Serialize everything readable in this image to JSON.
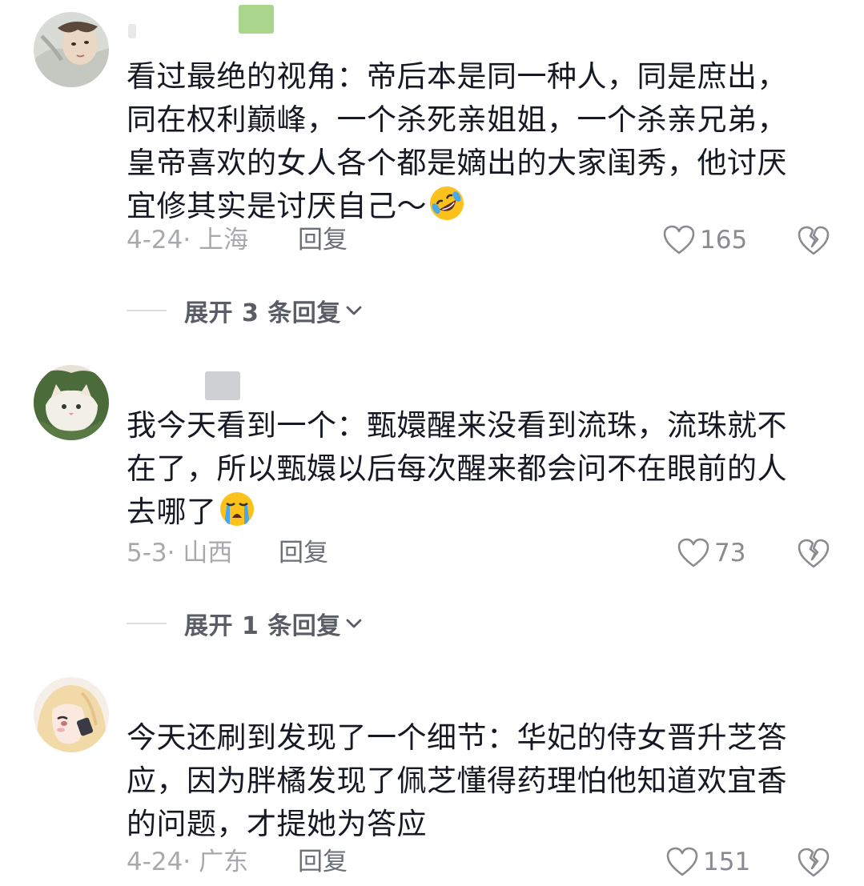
{
  "comments": [
    {
      "text": "看过最绝的视角：帝后本是同一种人，同是庶出，\n同在权利巅峰，一个杀死亲姐姐，一个杀亲兄弟，\n皇帝喜欢的女人各个都是嫡出的大家闺秀，他讨厌\n宜修其实是讨厌自己～",
      "emoji": "rolling-on-floor-laughing",
      "date": "4-24· 上海",
      "reply_label": "回复",
      "likes": "165",
      "expand_label": "展开 3 条回复"
    },
    {
      "text": "我今天看到一个：甄嬛醒来没看到流珠，流珠就不\n在了，所以甄嬛以后每次醒来都会问不在眼前的人\n去哪了",
      "emoji": "loudly-crying-face",
      "date": "5-3· 山西",
      "reply_label": "回复",
      "likes": "73",
      "expand_label": "展开 1 条回复"
    },
    {
      "text": "今天还刷到发现了一个细节：华妃的侍女晋升芝答\n应，因为胖橘发现了佩芝懂得药理怕他知道欢宜香\n的问题，才提她为答应",
      "emoji": "",
      "date": "4-24· 广东",
      "reply_label": "回复",
      "likes": "151",
      "expand_label": ""
    }
  ],
  "colors": {
    "text_primary": "#161823",
    "meta_gray": "#a8a9ad",
    "reply_gray": "#6d6f77",
    "expand_gray": "#5a5c66"
  }
}
